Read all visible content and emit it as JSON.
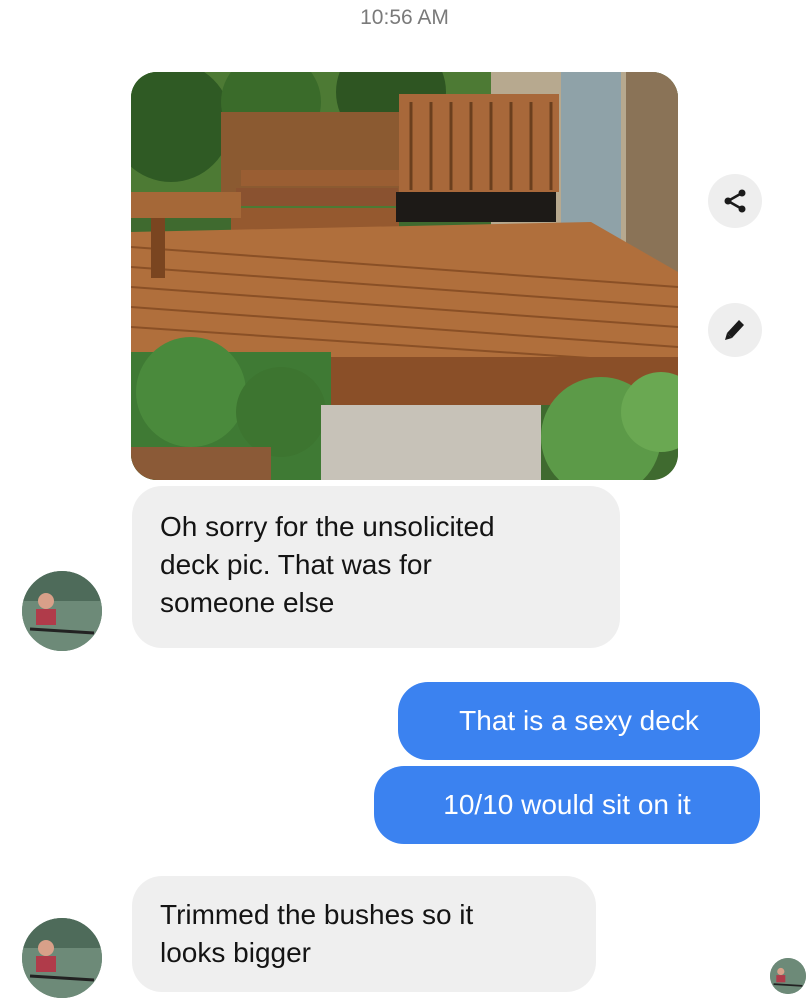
{
  "conversation": {
    "timestamp": "10:56 AM",
    "messages": [
      {
        "sender": "contact",
        "text_lines": [
          "Oh sorry for the unsolicited",
          "deck pic. That was for",
          "someone else"
        ]
      },
      {
        "sender": "me",
        "text": "That is a sexy deck"
      },
      {
        "sender": "me",
        "text": "10/10 would sit on it"
      },
      {
        "sender": "contact",
        "text_lines": [
          "Trimmed the bushes so it",
          "looks bigger"
        ]
      }
    ]
  },
  "photo_actions": {
    "share_icon": "share-icon",
    "edit_icon": "pencil-icon"
  },
  "colors": {
    "outgoing_bubble": "#3b82f0",
    "incoming_bubble": "#efefef",
    "timestamp": "#7a7a7a"
  }
}
